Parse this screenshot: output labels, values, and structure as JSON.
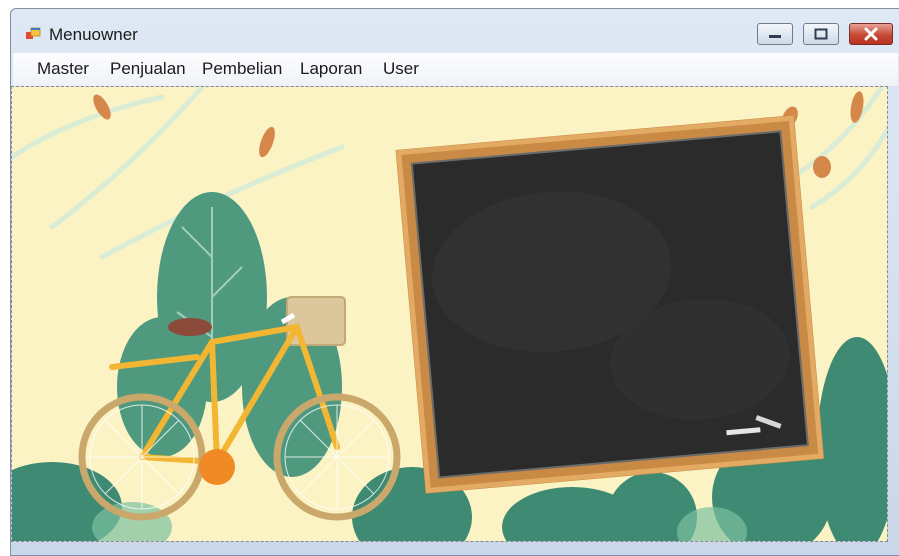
{
  "window": {
    "title": "Menuowner",
    "icon": "windows-form-icon"
  },
  "controls": {
    "minimize_icon": "minimize-icon",
    "maximize_icon": "maximize-icon",
    "close_icon": "close-icon"
  },
  "menu": {
    "items": [
      {
        "label": "Master"
      },
      {
        "label": "Penjualan"
      },
      {
        "label": "Pembelian"
      },
      {
        "label": "Laporan"
      },
      {
        "label": "User"
      }
    ]
  },
  "background_image": {
    "description_icon": "chalkboard-bicycle-illustration",
    "colors": {
      "sky": "#fbf3c4",
      "board": "#2b2b2b",
      "frame": "#c98a45",
      "leaf": "#3f8a73",
      "bike": "#f2b632"
    }
  }
}
